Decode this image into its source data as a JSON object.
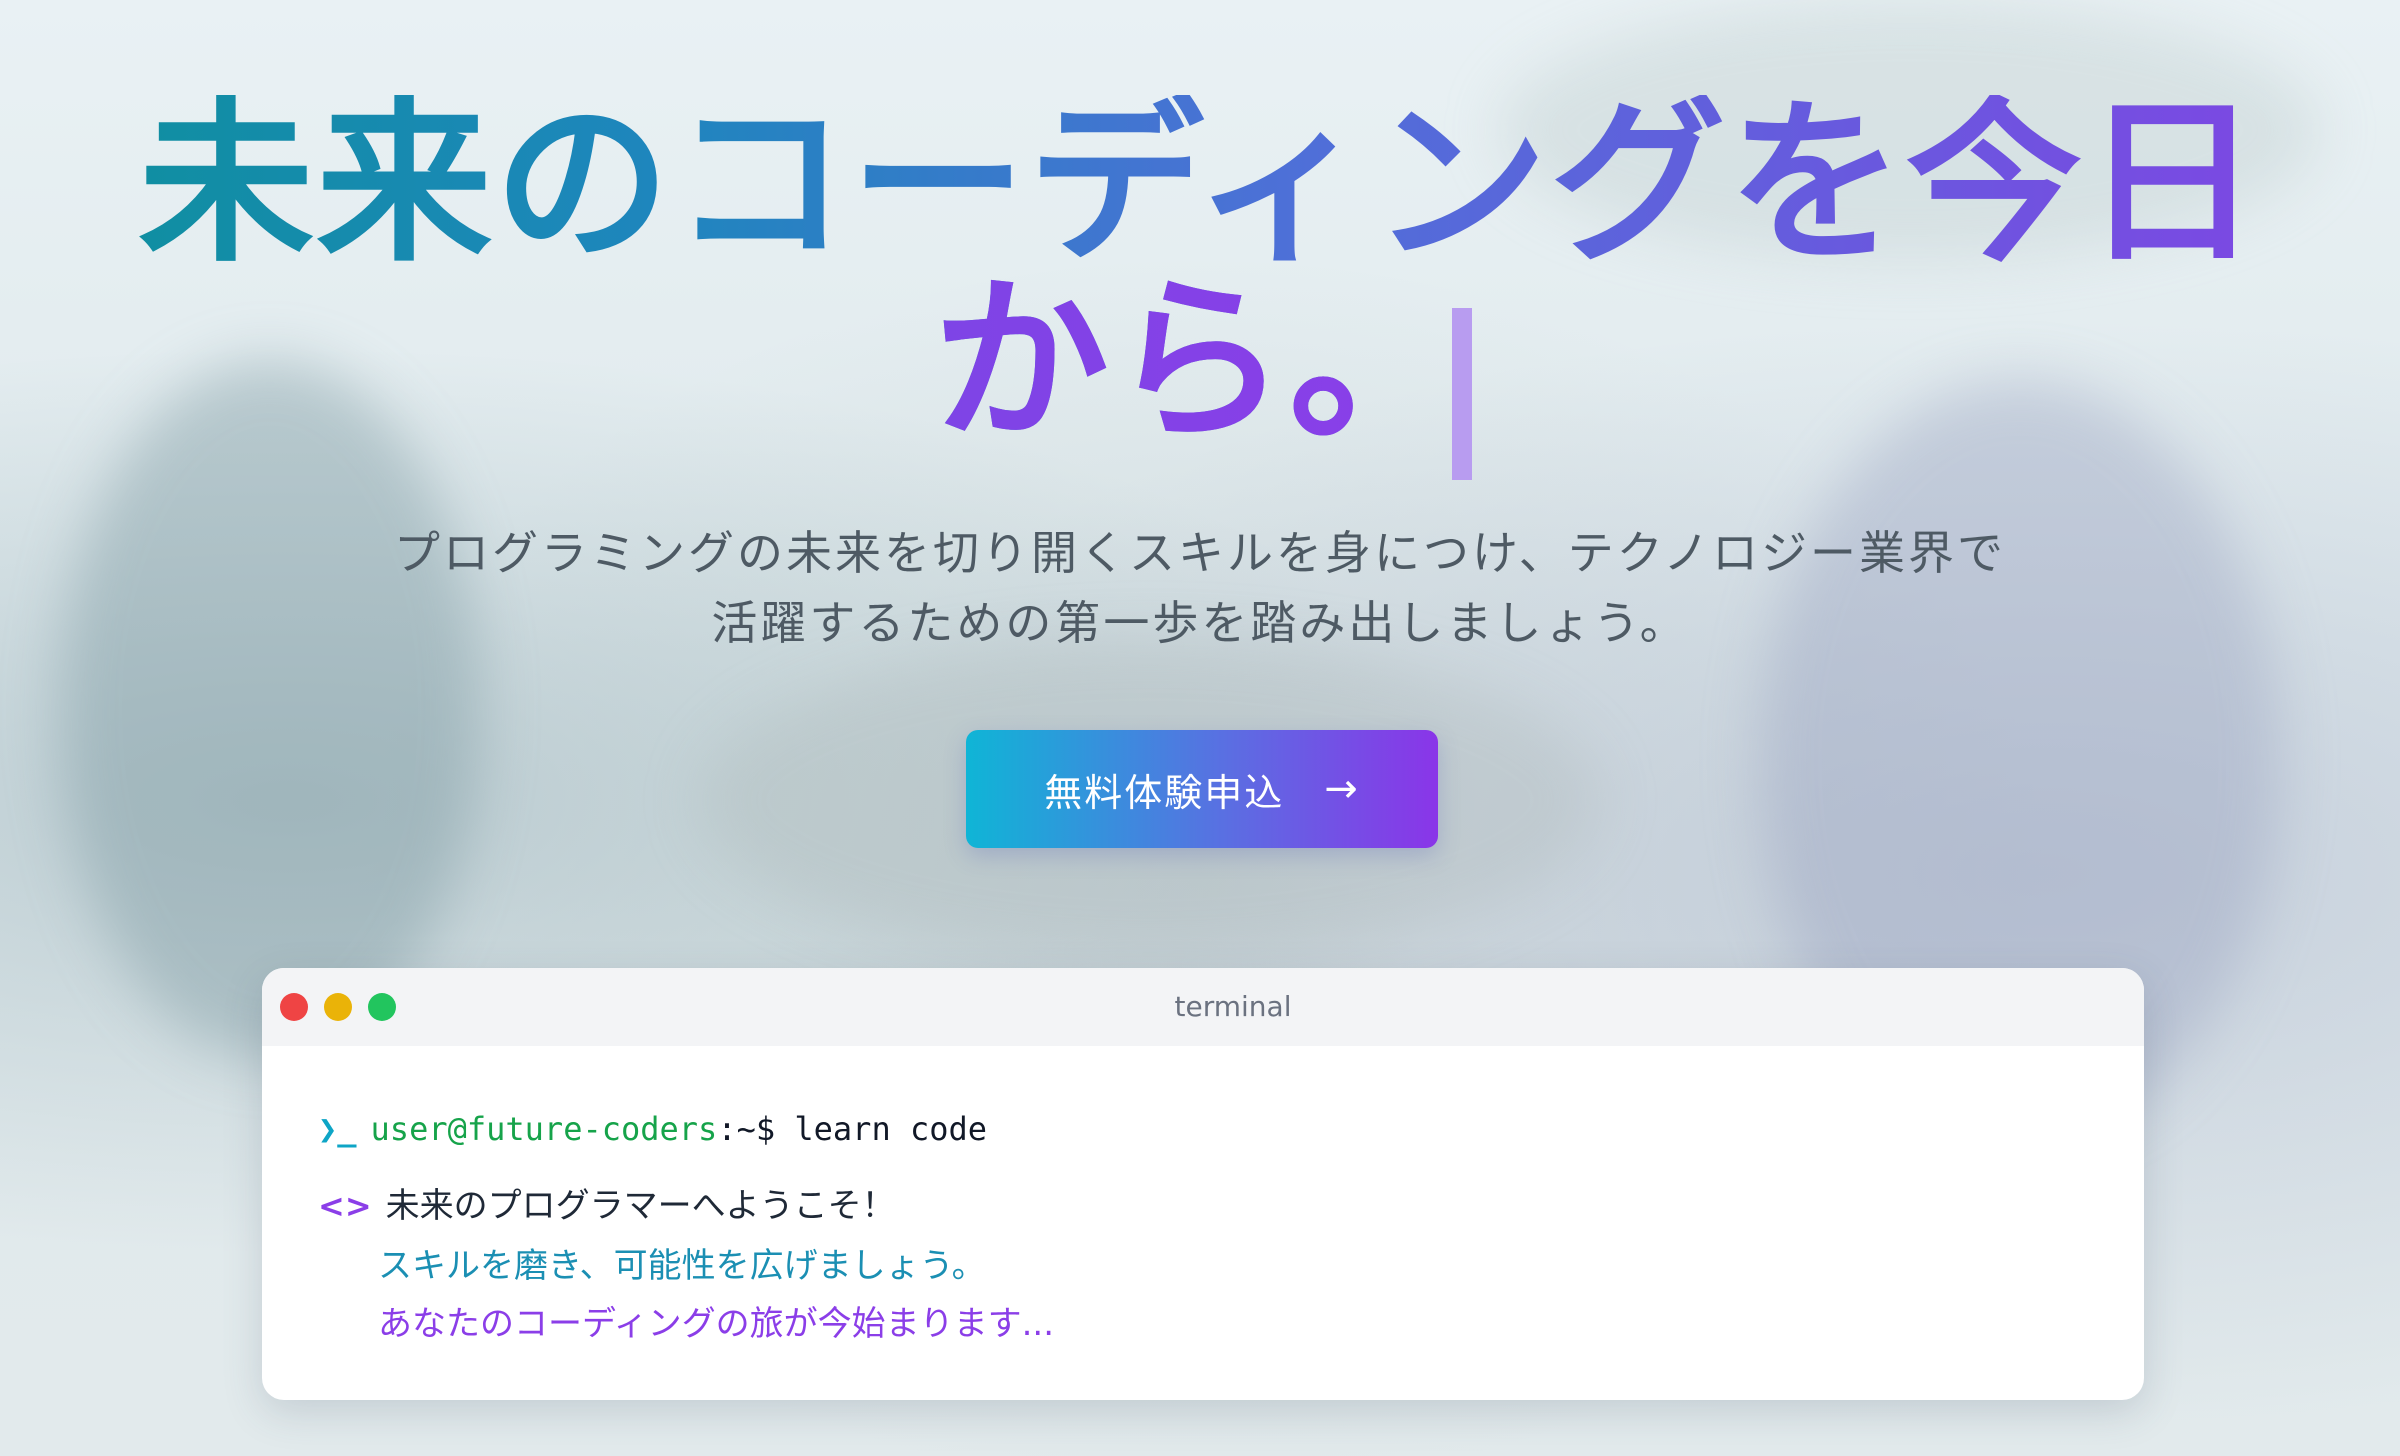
{
  "hero": {
    "title_line1": "未来のコーディングを今日",
    "title_line2": "から。",
    "subtitle_line1": "プログラミングの未来を切り開くスキルを身につけ、テクノロジー業界で",
    "subtitle_line2": "活躍するための第一歩を踏み出しましょう。"
  },
  "cta": {
    "label": "無料体験申込",
    "arrow": "→"
  },
  "terminal": {
    "title": "terminal",
    "prompt_icon": "❯_",
    "prompt_user": "user@future-coders",
    "prompt_sep": ":~$",
    "command": "learn code",
    "output_icon": "<>",
    "output_line1": "未来のプログラマーへようこそ！",
    "output_line2": "スキルを磨き、可能性を広げましょう。",
    "output_line3": "あなたのコーディングの旅が今始まります..."
  },
  "colors": {
    "brand_teal": "#0fb5d6",
    "brand_purple": "#8a35e8",
    "dot_red": "#ef4444",
    "dot_yellow": "#eab308",
    "dot_green": "#22c55e"
  }
}
